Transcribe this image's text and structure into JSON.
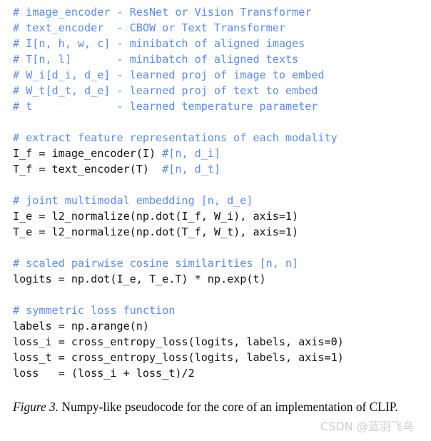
{
  "figure": {
    "background_color": "#ffffff",
    "comment_color": "#5b8cee",
    "code_color": "#141414",
    "caption_color": "#0d0d0d",
    "watermark_color": "#cfcfcf"
  },
  "code": {
    "language": "numpy-pseudocode",
    "lines": [
      {
        "type": "comment",
        "text": "# image_encoder - ResNet or Vision Transformer"
      },
      {
        "type": "comment",
        "text": "# text_encoder  - CBOW or Text Transformer"
      },
      {
        "type": "comment",
        "text": "# I[n, h, w, c] - minibatch of aligned images"
      },
      {
        "type": "comment",
        "text": "# T[n, l]       - minibatch of aligned texts"
      },
      {
        "type": "comment",
        "text": "# W_i[d_i, d_e] - learned proj of image to embed"
      },
      {
        "type": "comment",
        "text": "# W_t[d_t, d_e] - learned proj of text to embed"
      },
      {
        "type": "comment",
        "text": "# t             - learned temperature parameter"
      },
      {
        "type": "blank",
        "text": ""
      },
      {
        "type": "comment",
        "text": "# extract feature representations of each modality"
      },
      {
        "type": "mixed",
        "code": "I_f = image_encoder(I) ",
        "comment": "#[n, d_i]"
      },
      {
        "type": "mixed",
        "code": "T_f = text_encoder(T)  ",
        "comment": "#[n, d_t]"
      },
      {
        "type": "blank",
        "text": ""
      },
      {
        "type": "comment",
        "text": "# joint multimodal embedding [n, d_e]"
      },
      {
        "type": "code",
        "text": "I_e = l2_normalize(np.dot(I_f, W_i), axis=1)"
      },
      {
        "type": "code",
        "text": "T_e = l2_normalize(np.dot(T_f, W_t), axis=1)"
      },
      {
        "type": "blank",
        "text": ""
      },
      {
        "type": "comment",
        "text": "# scaled pairwise cosine similarities [n, n]"
      },
      {
        "type": "code",
        "text": "logits = np.dot(I_e, T_e.T) * np.exp(t)"
      },
      {
        "type": "blank",
        "text": ""
      },
      {
        "type": "comment",
        "text": "# symmetric loss function"
      },
      {
        "type": "code",
        "text": "labels = np.arange(n)"
      },
      {
        "type": "code",
        "text": "loss_i = cross_entropy_loss(logits, labels, axis=0)"
      },
      {
        "type": "code",
        "text": "loss_t = cross_entropy_loss(logits, labels, axis=1)"
      },
      {
        "type": "code",
        "text": "loss   = (loss_i + loss_t)/2"
      }
    ]
  },
  "caption": {
    "label": "Figure 3.",
    "text": " Numpy-like pseudocode for the core of an implementation of CLIP."
  },
  "watermark": {
    "text": "CSDN @蓝羽飞鸟"
  }
}
